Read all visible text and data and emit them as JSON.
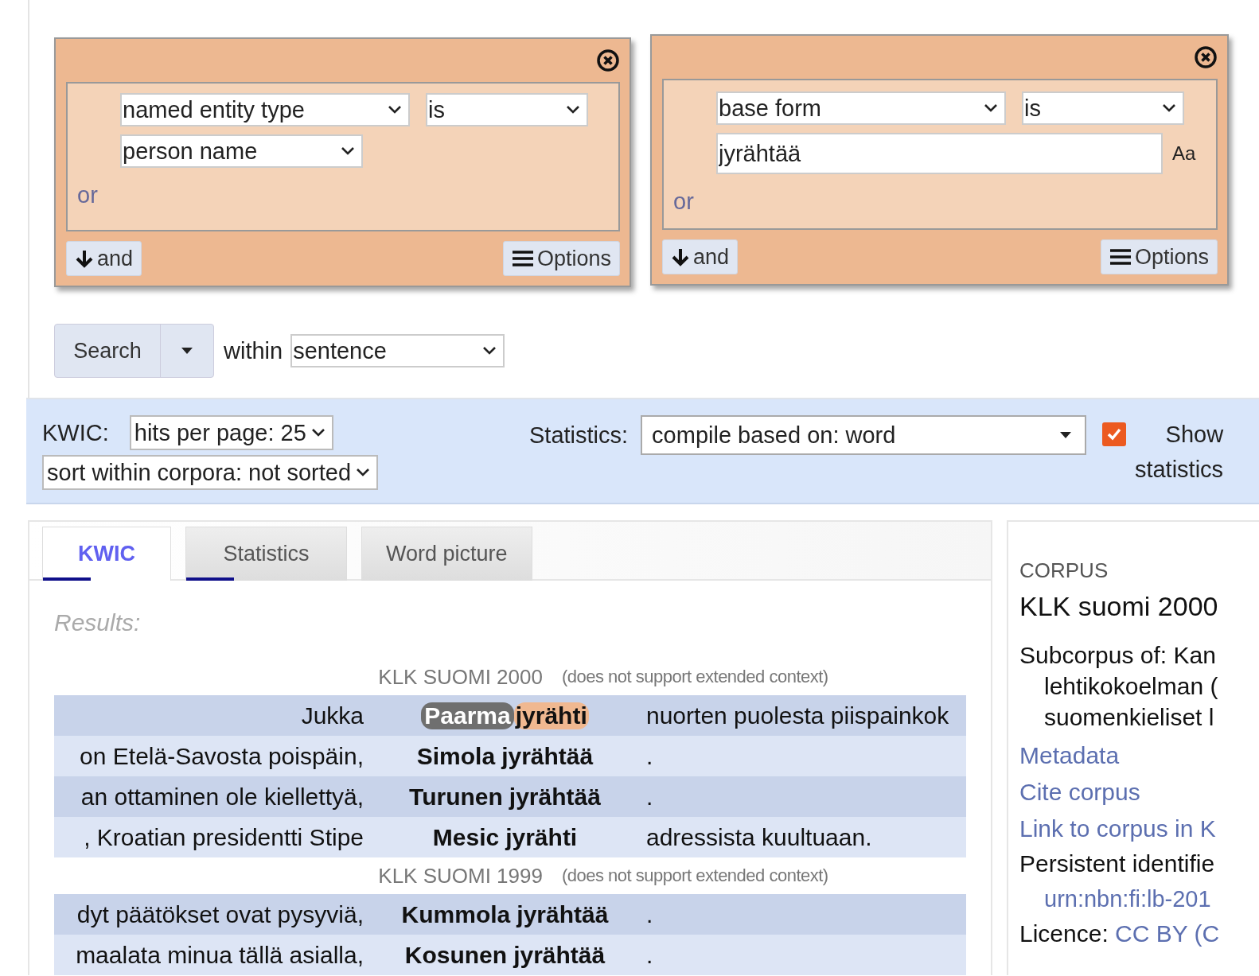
{
  "query_boxes": [
    {
      "attribute": "named entity type",
      "operator": "is",
      "value": {
        "kind": "select",
        "text": "person name"
      },
      "or_label": "or",
      "and_button": "and",
      "options_button": "Options"
    },
    {
      "attribute": "base form",
      "operator": "is",
      "value": {
        "kind": "text",
        "text": "jyrähtää",
        "case_label": "Aa"
      },
      "or_label": "or",
      "and_button": "and",
      "options_button": "Options"
    }
  ],
  "search": {
    "button": "Search",
    "within_label": "within",
    "within_value": "sentence"
  },
  "settings_bar": {
    "kwic_label": "KWIC:",
    "hits_per_page": "hits per page: 25",
    "sort": "sort within corpora: not sorted",
    "statistics_label": "Statistics:",
    "compile": "compile based on: word",
    "show_statistics": {
      "label": "Show statistics",
      "checked": true
    }
  },
  "tabs": [
    {
      "label": "KWIC",
      "selected": true,
      "loading": true
    },
    {
      "label": "Statistics",
      "selected": false,
      "loading": true
    },
    {
      "label": "Word picture",
      "selected": false,
      "loading": false
    }
  ],
  "results": {
    "heading": "Results:",
    "groups": [
      {
        "corpus": "KLK SUOMI 2000",
        "note": "(does not support extended context)",
        "rows": [
          {
            "left": "Jukka",
            "match": [
              {
                "text": "Paarma",
                "named_entity": true
              },
              {
                "text": "jyrähti",
                "named_entity": false
              }
            ],
            "right": "nuorten puolesta piispainkok",
            "selected": true
          },
          {
            "left": "on Etelä-Savosta poispäin,",
            "match": [
              {
                "text": "Simola"
              },
              {
                "text": "jyrähtää"
              }
            ],
            "right": ".",
            "selected": false
          },
          {
            "left": "an ottaminen ole kiellettyä,",
            "match": [
              {
                "text": "Turunen"
              },
              {
                "text": "jyrähtää"
              }
            ],
            "right": ".",
            "selected": false
          },
          {
            "left": ", Kroatian presidentti Stipe",
            "match": [
              {
                "text": "Mesic"
              },
              {
                "text": "jyrähti"
              }
            ],
            "right": "adressista kuultuaan.",
            "selected": false
          }
        ]
      },
      {
        "corpus": "KLK SUOMI 1999",
        "note": "(does not support extended context)",
        "rows": [
          {
            "left": "dyt päätökset ovat pysyviä,",
            "match": [
              {
                "text": "Kummola"
              },
              {
                "text": "jyrähtää"
              }
            ],
            "right": ".",
            "selected": false
          },
          {
            "left": "maalata minua tällä asialla,",
            "match": [
              {
                "text": "Kosunen"
              },
              {
                "text": "jyrähtää"
              }
            ],
            "right": ".",
            "selected": false
          }
        ]
      }
    ]
  },
  "corpus_panel": {
    "heading": "CORPUS",
    "title": "KLK suomi 2000",
    "subcorpus_lines": [
      "Subcorpus of: Kan",
      "lehtikokoelman (",
      "suomenkieliset l"
    ],
    "links": [
      "Metadata",
      "Cite corpus",
      "Link to corpus in K"
    ],
    "persistent_label": "Persistent identifie",
    "persistent_value": "urn:nbn:fi:lb-201",
    "licence_label": "Licence:",
    "licence_value": "CC BY (C"
  }
}
